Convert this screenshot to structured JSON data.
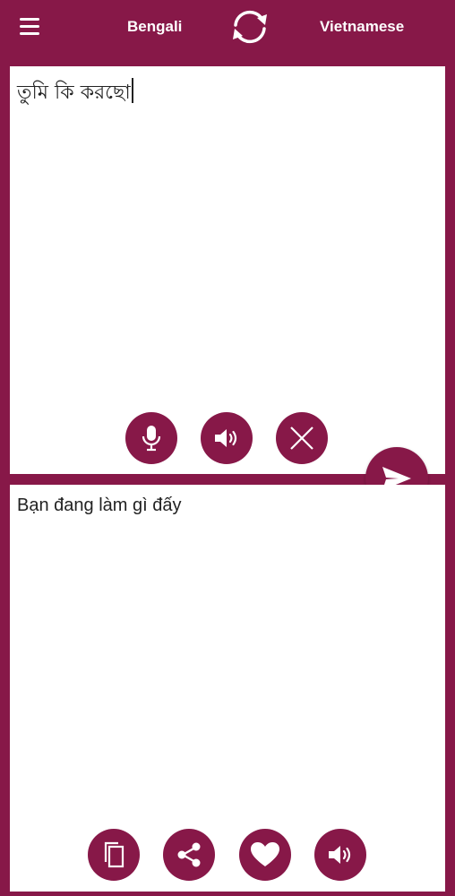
{
  "header": {
    "source_language": "Bengali",
    "target_language": "Vietnamese"
  },
  "source_panel": {
    "text": "তুমি কি করছো"
  },
  "target_panel": {
    "text": "Bạn đang làm gì đấy"
  },
  "icons": {
    "menu": "hamburger-menu-icon",
    "swap": "swap-languages-icon",
    "mic": "microphone-icon",
    "speaker": "speaker-icon",
    "clear": "close-icon",
    "send": "send-icon",
    "copy": "copy-icon",
    "share": "share-icon",
    "favorite": "heart-icon"
  },
  "colors": {
    "primary": "#871848",
    "panel": "#ffffff",
    "text": "#222222"
  }
}
